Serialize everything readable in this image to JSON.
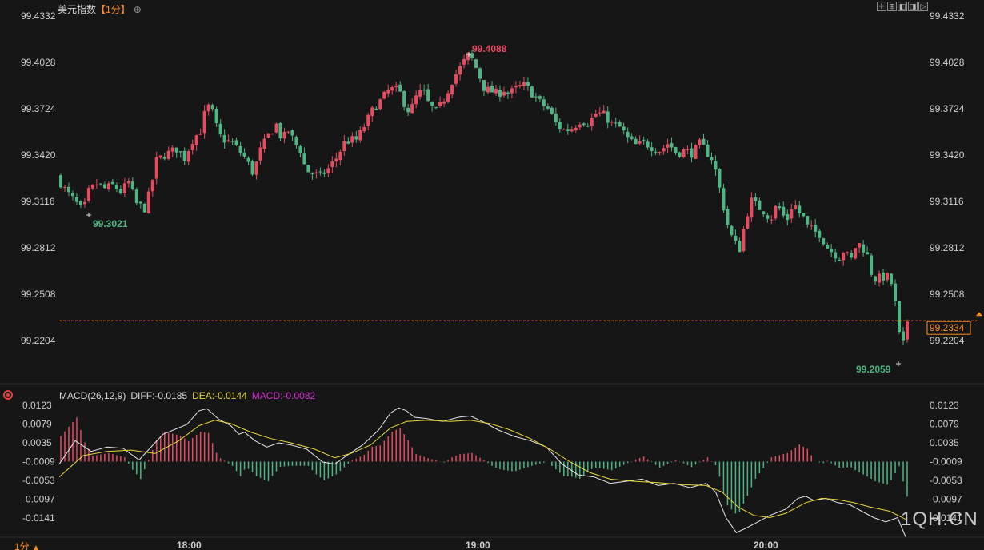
{
  "header": {
    "title": "美元指数",
    "period": "【1分】",
    "target_icon": "crosshair-target-icon"
  },
  "toolbar": {
    "buttons": [
      {
        "icon": "crosshair-icon",
        "glyph": "✛"
      },
      {
        "icon": "zoom-in-icon",
        "glyph": "⊞"
      },
      {
        "icon": "scroll-left-icon",
        "glyph": "◧"
      },
      {
        "icon": "scroll-right-icon",
        "glyph": "◨"
      },
      {
        "icon": "scroll-end-icon",
        "glyph": "▷"
      }
    ]
  },
  "price_axis": {
    "ticks": [
      "99.4332",
      "99.4028",
      "99.3724",
      "99.3420",
      "99.3116",
      "99.2812",
      "99.2508",
      "99.2204"
    ]
  },
  "current_price": "99.2334",
  "annotations": {
    "high": "99.4088",
    "low_left": "99.3021",
    "low_right": "99.2059"
  },
  "time_axis": [
    "18:00",
    "19:00",
    "20:00"
  ],
  "macd": {
    "name": "MACD(26,12,9)",
    "diff": "DIFF:-0.0185",
    "dea": "DEA:-0.0144",
    "macd": "MACD:-0.0082",
    "ticks": [
      "0.0123",
      "0.0079",
      "0.0035",
      "-0.0009",
      "-0.0053",
      "-0.0097",
      "-0.0141"
    ]
  },
  "period_switch": "1分",
  "watermark": "1QH.CN",
  "colors": {
    "up": "#e84a5f",
    "down": "#4cb782",
    "diff_line": "#e6e6e6",
    "dea_line": "#e5d83a",
    "macd_text": "#d52fd5",
    "current_price": "#ff8c1a",
    "period": "#ff8c1a"
  },
  "chart_data": [
    {
      "type": "candlestick",
      "title": "美元指数",
      "ylim": [
        99.2,
        99.44
      ],
      "y_ticks": [
        99.4332,
        99.4028,
        99.3724,
        99.342,
        99.3116,
        99.2812,
        99.2508,
        99.2204
      ],
      "x_ticks": [
        "18:00",
        "19:00",
        "20:00"
      ],
      "last_price": 99.2334,
      "high": 99.4088,
      "low": 99.2059,
      "path": [
        [
          0,
          99.328
        ],
        [
          12,
          99.318
        ],
        [
          22,
          99.312
        ],
        [
          33,
          99.305
        ],
        [
          40,
          99.318
        ],
        [
          50,
          99.323
        ],
        [
          60,
          99.32
        ],
        [
          70,
          99.322
        ],
        [
          80,
          99.318
        ],
        [
          90,
          99.324
        ],
        [
          100,
          99.31
        ],
        [
          110,
          99.307
        ],
        [
          118,
          99.32
        ],
        [
          124,
          99.338
        ],
        [
          135,
          99.342
        ],
        [
          150,
          99.346
        ],
        [
          160,
          99.34
        ],
        [
          170,
          99.352
        ],
        [
          180,
          99.358
        ],
        [
          188,
          99.375
        ],
        [
          195,
          99.37
        ],
        [
          203,
          99.355
        ],
        [
          210,
          99.352
        ],
        [
          220,
          99.35
        ],
        [
          228,
          99.345
        ],
        [
          236,
          99.34
        ],
        [
          246,
          99.33
        ],
        [
          255,
          99.345
        ],
        [
          265,
          99.355
        ],
        [
          275,
          99.362
        ],
        [
          282,
          99.352
        ],
        [
          290,
          99.358
        ],
        [
          298,
          99.35
        ],
        [
          305,
          99.345
        ],
        [
          312,
          99.332
        ],
        [
          320,
          99.33
        ],
        [
          330,
          99.328
        ],
        [
          340,
          99.333
        ],
        [
          350,
          99.34
        ],
        [
          360,
          99.35
        ],
        [
          368,
          99.352
        ],
        [
          376,
          99.352
        ],
        [
          386,
          99.362
        ],
        [
          396,
          99.372
        ],
        [
          406,
          99.378
        ],
        [
          416,
          99.385
        ],
        [
          428,
          99.385
        ],
        [
          436,
          99.375
        ],
        [
          442,
          99.37
        ],
        [
          450,
          99.38
        ],
        [
          458,
          99.385
        ],
        [
          466,
          99.375
        ],
        [
          476,
          99.37
        ],
        [
          486,
          99.38
        ],
        [
          496,
          99.392
        ],
        [
          506,
          99.4
        ],
        [
          512,
          99.405
        ],
        [
          516,
          99.408
        ],
        [
          522,
          99.403
        ],
        [
          530,
          99.393
        ],
        [
          536,
          99.385
        ],
        [
          544,
          99.384
        ],
        [
          552,
          99.382
        ],
        [
          560,
          99.385
        ],
        [
          566,
          99.382
        ],
        [
          576,
          99.386
        ],
        [
          586,
          99.388
        ],
        [
          596,
          99.382
        ],
        [
          606,
          99.376
        ],
        [
          616,
          99.372
        ],
        [
          626,
          99.362
        ],
        [
          636,
          99.358
        ],
        [
          646,
          99.36
        ],
        [
          656,
          99.365
        ],
        [
          666,
          99.363
        ],
        [
          676,
          99.37
        ],
        [
          686,
          99.368
        ],
        [
          696,
          99.362
        ],
        [
          706,
          99.36
        ],
        [
          716,
          99.352
        ],
        [
          726,
          99.348
        ],
        [
          736,
          99.35
        ],
        [
          746,
          99.347
        ],
        [
          756,
          99.345
        ],
        [
          766,
          99.35
        ],
        [
          776,
          99.343
        ],
        [
          786,
          99.345
        ],
        [
          796,
          99.343
        ],
        [
          806,
          99.35
        ],
        [
          812,
          99.345
        ],
        [
          820,
          99.34
        ],
        [
          826,
          99.33
        ],
        [
          834,
          99.31
        ],
        [
          842,
          99.292
        ],
        [
          848,
          99.285
        ],
        [
          856,
          99.28
        ],
        [
          862,
          99.3
        ],
        [
          870,
          99.312
        ],
        [
          878,
          99.308
        ],
        [
          886,
          99.305
        ],
        [
          894,
          99.3
        ],
        [
          902,
          99.31
        ],
        [
          910,
          99.302
        ],
        [
          916,
          99.3
        ],
        [
          922,
          99.312
        ],
        [
          928,
          99.305
        ],
        [
          934,
          99.302
        ],
        [
          940,
          99.295
        ],
        [
          948,
          99.292
        ],
        [
          956,
          99.29
        ],
        [
          964,
          99.282
        ],
        [
          972,
          99.278
        ],
        [
          980,
          99.275
        ],
        [
          986,
          99.28
        ],
        [
          994,
          99.272
        ],
        [
          1002,
          99.285
        ],
        [
          1008,
          99.282
        ],
        [
          1014,
          99.278
        ],
        [
          1020,
          99.265
        ],
        [
          1026,
          99.26
        ],
        [
          1032,
          99.262
        ],
        [
          1040,
          99.262
        ],
        [
          1046,
          99.257
        ],
        [
          1052,
          99.238
        ],
        [
          1058,
          99.21
        ],
        [
          1064,
          99.2334
        ]
      ]
    },
    {
      "type": "line",
      "title": "MACD(26,12,9)",
      "ylim": [
        -0.0185,
        0.0135
      ],
      "y_ticks": [
        0.0123,
        0.0079,
        0.0035,
        -0.0009,
        -0.0053,
        -0.0097,
        -0.0141
      ],
      "series": [
        {
          "name": "DIFF",
          "last": -0.0185,
          "points": [
            [
              0,
              -0.0015
            ],
            [
              20,
              0.004
            ],
            [
              40,
              0.0015
            ],
            [
              60,
              0.0025
            ],
            [
              80,
              0.0022
            ],
            [
              100,
              -0.0005
            ],
            [
              130,
              0.0055
            ],
            [
              160,
              0.0078
            ],
            [
              175,
              0.011
            ],
            [
              185,
              0.0115
            ],
            [
              200,
              0.009
            ],
            [
              215,
              0.0075
            ],
            [
              225,
              0.0055
            ],
            [
              232,
              0.006
            ],
            [
              245,
              0.004
            ],
            [
              260,
              0.0025
            ],
            [
              275,
              0.0035
            ],
            [
              290,
              0.003
            ],
            [
              310,
              0.002
            ],
            [
              330,
              -0.001
            ],
            [
              345,
              -0.0015
            ],
            [
              360,
              0.0005
            ],
            [
              380,
              0.003
            ],
            [
              400,
              0.0065
            ],
            [
              415,
              0.0105
            ],
            [
              425,
              0.0117
            ],
            [
              435,
              0.011
            ],
            [
              445,
              0.0095
            ],
            [
              460,
              0.0092
            ],
            [
              480,
              0.0085
            ],
            [
              500,
              0.0095
            ],
            [
              515,
              0.0098
            ],
            [
              530,
              0.0085
            ],
            [
              550,
              0.0065
            ],
            [
              570,
              0.005
            ],
            [
              590,
              0.004
            ],
            [
              610,
              0.0025
            ],
            [
              630,
              -0.0015
            ],
            [
              650,
              -0.004
            ],
            [
              670,
              -0.0045
            ],
            [
              690,
              -0.006
            ],
            [
              710,
              -0.0055
            ],
            [
              730,
              -0.005
            ],
            [
              750,
              -0.0065
            ],
            [
              770,
              -0.006
            ],
            [
              790,
              -0.007
            ],
            [
              810,
              -0.006
            ],
            [
              822,
              -0.008
            ],
            [
              835,
              -0.014
            ],
            [
              848,
              -0.0175
            ],
            [
              860,
              -0.0165
            ],
            [
              875,
              -0.015
            ],
            [
              890,
              -0.0135
            ],
            [
              910,
              -0.012
            ],
            [
              925,
              -0.0095
            ],
            [
              935,
              -0.009
            ],
            [
              945,
              -0.01
            ],
            [
              960,
              -0.0095
            ],
            [
              975,
              -0.0105
            ],
            [
              990,
              -0.011
            ],
            [
              1005,
              -0.0125
            ],
            [
              1020,
              -0.014
            ],
            [
              1035,
              -0.015
            ],
            [
              1050,
              -0.014
            ],
            [
              1060,
              -0.0185
            ]
          ]
        },
        {
          "name": "DEA",
          "last": -0.0144,
          "points": [
            [
              0,
              -0.0045
            ],
            [
              30,
              0.0005
            ],
            [
              60,
              0.0015
            ],
            [
              90,
              0.0018
            ],
            [
              120,
              0.001
            ],
            [
              150,
              0.004
            ],
            [
              175,
              0.0075
            ],
            [
              195,
              0.0088
            ],
            [
              215,
              0.008
            ],
            [
              240,
              0.006
            ],
            [
              265,
              0.0045
            ],
            [
              290,
              0.0035
            ],
            [
              320,
              0.002
            ],
            [
              345,
              0.0
            ],
            [
              365,
              0.001
            ],
            [
              390,
              0.003
            ],
            [
              415,
              0.007
            ],
            [
              435,
              0.0085
            ],
            [
              460,
              0.0088
            ],
            [
              490,
              0.0085
            ],
            [
              515,
              0.0088
            ],
            [
              540,
              0.008
            ],
            [
              565,
              0.0065
            ],
            [
              590,
              0.0045
            ],
            [
              615,
              0.002
            ],
            [
              640,
              -0.001
            ],
            [
              665,
              -0.0035
            ],
            [
              690,
              -0.005
            ],
            [
              720,
              -0.0055
            ],
            [
              750,
              -0.0058
            ],
            [
              780,
              -0.0063
            ],
            [
              810,
              -0.0065
            ],
            [
              830,
              -0.008
            ],
            [
              850,
              -0.0115
            ],
            [
              870,
              -0.0135
            ],
            [
              890,
              -0.014
            ],
            [
              910,
              -0.013
            ],
            [
              935,
              -0.0105
            ],
            [
              955,
              -0.0095
            ],
            [
              975,
              -0.0098
            ],
            [
              995,
              -0.0105
            ],
            [
              1015,
              -0.0115
            ],
            [
              1040,
              -0.0125
            ],
            [
              1060,
              -0.0144
            ]
          ]
        },
        {
          "name": "MACD",
          "type": "bar",
          "last": -0.0082
        }
      ]
    }
  ]
}
